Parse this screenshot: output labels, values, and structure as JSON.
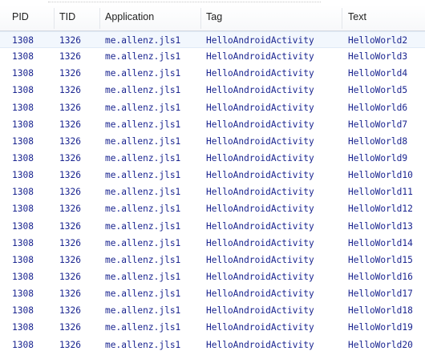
{
  "columns": [
    {
      "key": "pid",
      "label": "PID"
    },
    {
      "key": "tid",
      "label": "TID"
    },
    {
      "key": "application",
      "label": "Application"
    },
    {
      "key": "tag",
      "label": "Tag"
    },
    {
      "key": "text",
      "label": "Text"
    }
  ],
  "colors": {
    "log_text": "#1a2590",
    "selected_row_bg": "#f2f7fd",
    "header_text": "#1e1e1e"
  },
  "rows": [
    {
      "pid": "1308",
      "tid": "1326",
      "application": "me.allenz.jls1",
      "tag": "HelloAndroidActivity",
      "text": "HelloWorld2",
      "selected": true
    },
    {
      "pid": "1308",
      "tid": "1326",
      "application": "me.allenz.jls1",
      "tag": "HelloAndroidActivity",
      "text": "HelloWorld3"
    },
    {
      "pid": "1308",
      "tid": "1326",
      "application": "me.allenz.jls1",
      "tag": "HelloAndroidActivity",
      "text": "HelloWorld4"
    },
    {
      "pid": "1308",
      "tid": "1326",
      "application": "me.allenz.jls1",
      "tag": "HelloAndroidActivity",
      "text": "HelloWorld5"
    },
    {
      "pid": "1308",
      "tid": "1326",
      "application": "me.allenz.jls1",
      "tag": "HelloAndroidActivity",
      "text": "HelloWorld6"
    },
    {
      "pid": "1308",
      "tid": "1326",
      "application": "me.allenz.jls1",
      "tag": "HelloAndroidActivity",
      "text": "HelloWorld7"
    },
    {
      "pid": "1308",
      "tid": "1326",
      "application": "me.allenz.jls1",
      "tag": "HelloAndroidActivity",
      "text": "HelloWorld8"
    },
    {
      "pid": "1308",
      "tid": "1326",
      "application": "me.allenz.jls1",
      "tag": "HelloAndroidActivity",
      "text": "HelloWorld9"
    },
    {
      "pid": "1308",
      "tid": "1326",
      "application": "me.allenz.jls1",
      "tag": "HelloAndroidActivity",
      "text": "HelloWorld10"
    },
    {
      "pid": "1308",
      "tid": "1326",
      "application": "me.allenz.jls1",
      "tag": "HelloAndroidActivity",
      "text": "HelloWorld11"
    },
    {
      "pid": "1308",
      "tid": "1326",
      "application": "me.allenz.jls1",
      "tag": "HelloAndroidActivity",
      "text": "HelloWorld12"
    },
    {
      "pid": "1308",
      "tid": "1326",
      "application": "me.allenz.jls1",
      "tag": "HelloAndroidActivity",
      "text": "HelloWorld13"
    },
    {
      "pid": "1308",
      "tid": "1326",
      "application": "me.allenz.jls1",
      "tag": "HelloAndroidActivity",
      "text": "HelloWorld14"
    },
    {
      "pid": "1308",
      "tid": "1326",
      "application": "me.allenz.jls1",
      "tag": "HelloAndroidActivity",
      "text": "HelloWorld15"
    },
    {
      "pid": "1308",
      "tid": "1326",
      "application": "me.allenz.jls1",
      "tag": "HelloAndroidActivity",
      "text": "HelloWorld16"
    },
    {
      "pid": "1308",
      "tid": "1326",
      "application": "me.allenz.jls1",
      "tag": "HelloAndroidActivity",
      "text": "HelloWorld17"
    },
    {
      "pid": "1308",
      "tid": "1326",
      "application": "me.allenz.jls1",
      "tag": "HelloAndroidActivity",
      "text": "HelloWorld18"
    },
    {
      "pid": "1308",
      "tid": "1326",
      "application": "me.allenz.jls1",
      "tag": "HelloAndroidActivity",
      "text": "HelloWorld19"
    },
    {
      "pid": "1308",
      "tid": "1326",
      "application": "me.allenz.jls1",
      "tag": "HelloAndroidActivity",
      "text": "HelloWorld20"
    }
  ]
}
